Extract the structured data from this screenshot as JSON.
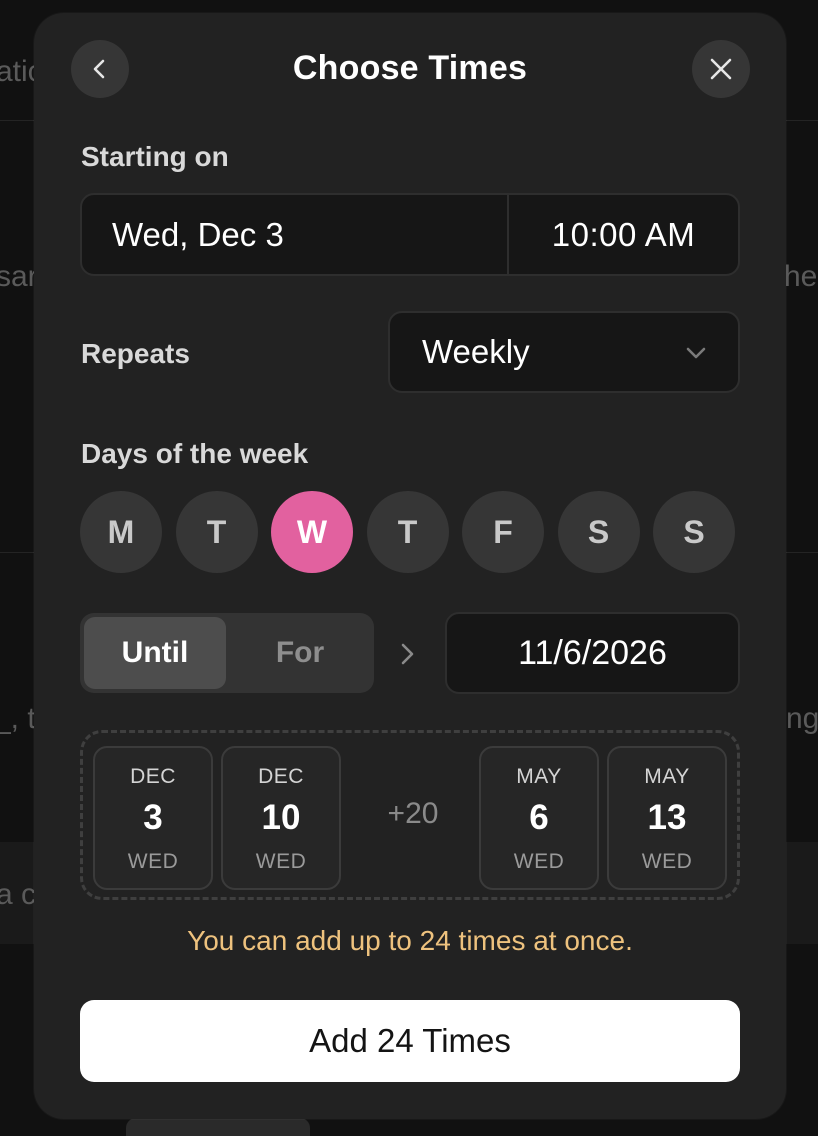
{
  "background": {
    "fragments": [
      "atic",
      "sar",
      "he",
      "_, t",
      "nge",
      "a c"
    ]
  },
  "modal": {
    "title": "Choose Times",
    "back_icon": "chevron-left-icon",
    "close_icon": "close-icon",
    "starting_label": "Starting on",
    "start_date": "Wed, Dec 3",
    "start_time": "10:00  AM",
    "repeats_label": "Repeats",
    "repeat_value": "Weekly",
    "repeat_chevron": "chevron-down-icon",
    "days_label": "Days of the week",
    "days": [
      {
        "label": "M",
        "active": false
      },
      {
        "label": "T",
        "active": false
      },
      {
        "label": "W",
        "active": true
      },
      {
        "label": "T",
        "active": false
      },
      {
        "label": "F",
        "active": false
      },
      {
        "label": "S",
        "active": false
      },
      {
        "label": "S",
        "active": false
      }
    ],
    "end_mode": {
      "options": [
        "Until",
        "For"
      ],
      "selected": "Until"
    },
    "end_date": "11/6/2026",
    "preview": {
      "first": [
        {
          "month": "DEC",
          "day": "3",
          "weekday": "WED"
        },
        {
          "month": "DEC",
          "day": "10",
          "weekday": "WED"
        }
      ],
      "more": "+20",
      "last": [
        {
          "month": "MAY",
          "day": "6",
          "weekday": "WED"
        },
        {
          "month": "MAY",
          "day": "13",
          "weekday": "WED"
        }
      ]
    },
    "warning": "You can add up to 24 times at once.",
    "add_button": "Add 24 Times"
  },
  "colors": {
    "accent": "#e2619f",
    "warning": "#eec27e",
    "modal_bg": "#222222"
  }
}
